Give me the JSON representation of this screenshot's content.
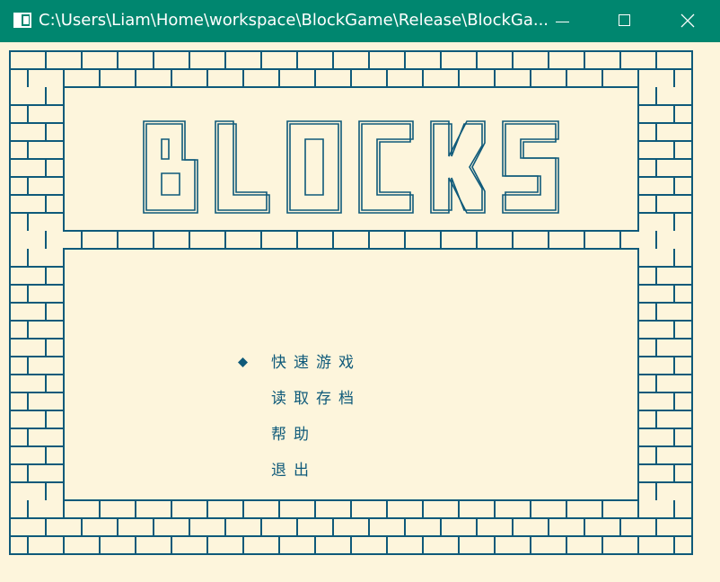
{
  "window": {
    "title": "C:\\Users\\Liam\\Home\\workspace\\BlockGame\\Release\\BlockGa...",
    "icon": "console-app-icon",
    "controls": [
      "minimize-icon",
      "maximize-icon",
      "close-icon"
    ]
  },
  "game": {
    "logo_text": "BLOCKS",
    "menu": {
      "items": [
        {
          "label": "快速游戏",
          "selected": true
        },
        {
          "label": "读取存档",
          "selected": false
        },
        {
          "label": "帮助",
          "selected": false
        },
        {
          "label": "退出",
          "selected": false
        }
      ],
      "cursor_icon": "diamond-cursor-icon"
    },
    "colors": {
      "background": "#fdf5dc",
      "line": "#0f5a7a",
      "titlebar": "#00866f"
    }
  }
}
